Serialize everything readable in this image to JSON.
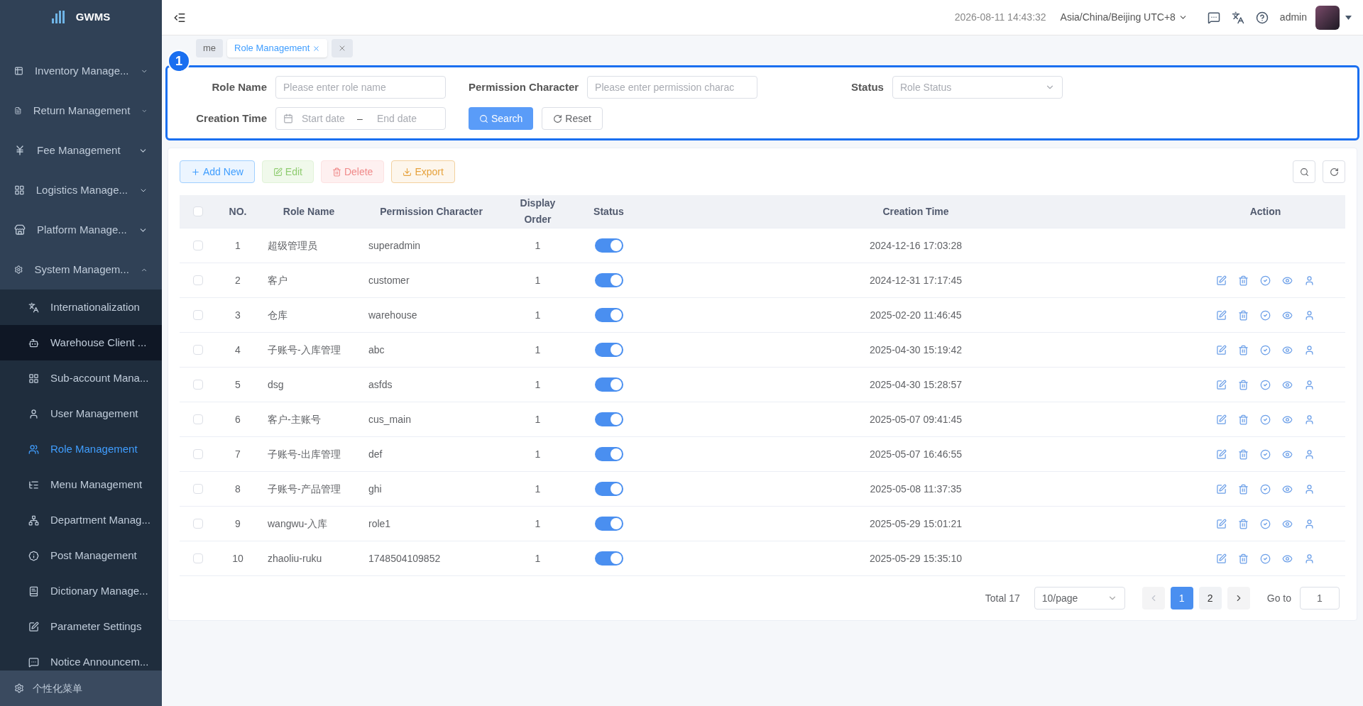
{
  "sidebar": {
    "logo": "GWMS",
    "items": [
      {
        "label": "Inventory Manage...",
        "expanded": false
      },
      {
        "label": "Return Management",
        "expanded": false
      },
      {
        "label": "Fee Management",
        "expanded": false
      },
      {
        "label": "Logistics Manage...",
        "expanded": false
      },
      {
        "label": "Platform Manage...",
        "expanded": false
      },
      {
        "label": "System Managem...",
        "expanded": true,
        "children": [
          {
            "label": "Internationalization",
            "selected": false
          },
          {
            "label": "Warehouse Client ...",
            "selected": false
          },
          {
            "label": "Sub-account Mana...",
            "selected": false
          },
          {
            "label": "User Management",
            "selected": false
          },
          {
            "label": "Role Management",
            "selected": true
          },
          {
            "label": "Menu Management",
            "selected": false
          },
          {
            "label": "Department Manag...",
            "selected": false
          },
          {
            "label": "Post Management",
            "selected": false
          },
          {
            "label": "Dictionary Manage...",
            "selected": false
          },
          {
            "label": "Parameter Settings",
            "selected": false
          },
          {
            "label": "Notice Announcem...",
            "selected": false
          }
        ]
      }
    ],
    "footer": "个性化菜单"
  },
  "header": {
    "datetime": "2026-08-11 14:43:32",
    "timezone": "Asia/China/Beijing UTC+8",
    "user": "admin"
  },
  "tabs": [
    {
      "kind": "page",
      "label": "me",
      "selected": false
    },
    {
      "kind": "page",
      "label": "Role Management",
      "selected": true
    },
    {
      "kind": "close-all",
      "selected": false
    }
  ],
  "callout": {
    "label": "1"
  },
  "filters": {
    "role_name": {
      "label": "Role Name",
      "placeholder": "Please enter role name"
    },
    "permission": {
      "label": "Permission Character",
      "placeholder": "Please enter permission charac"
    },
    "status": {
      "label": "Status",
      "placeholder": "Role Status"
    },
    "creation_time": {
      "label": "Creation Time",
      "start_placeholder": "Start date",
      "separator": "–",
      "end_placeholder": "End date"
    },
    "search": "Search",
    "reset": "Reset"
  },
  "toolbar": [
    {
      "kind": "primary",
      "label": "Add New",
      "disabled": false
    },
    {
      "kind": "success",
      "label": "Edit",
      "disabled": true
    },
    {
      "kind": "danger",
      "label": "Delete",
      "disabled": true
    },
    {
      "kind": "warning",
      "label": "Export",
      "disabled": false
    }
  ],
  "table": {
    "select_all_checked": false,
    "columns": [
      "NO.",
      "Role Name",
      "Permission Character",
      "Display Order",
      "Status",
      "Creation Time",
      "Action"
    ],
    "rows": [
      {
        "no": "1",
        "name": "超级管理员",
        "permission": "superadmin",
        "order": "1",
        "on": true,
        "time": "2024-12-16 17:03:28",
        "actions": false,
        "checked": false
      },
      {
        "no": "2",
        "name": "客户",
        "permission": "customer",
        "order": "1",
        "on": true,
        "time": "2024-12-31 17:17:45",
        "actions": true,
        "checked": false
      },
      {
        "no": "3",
        "name": "仓库",
        "permission": "warehouse",
        "order": "1",
        "on": true,
        "time": "2025-02-20 11:46:45",
        "actions": true,
        "checked": false
      },
      {
        "no": "4",
        "name": "子账号-入库管理",
        "permission": "abc",
        "order": "1",
        "on": true,
        "time": "2025-04-30 15:19:42",
        "actions": true,
        "checked": false
      },
      {
        "no": "5",
        "name": "dsg",
        "permission": "asfds",
        "order": "1",
        "on": true,
        "time": "2025-04-30 15:28:57",
        "actions": true,
        "checked": false
      },
      {
        "no": "6",
        "name": "客户-主账号",
        "permission": "cus_main",
        "order": "1",
        "on": true,
        "time": "2025-05-07 09:41:45",
        "actions": true,
        "checked": false
      },
      {
        "no": "7",
        "name": "子账号-出库管理",
        "permission": "def",
        "order": "1",
        "on": true,
        "time": "2025-05-07 16:46:55",
        "actions": true,
        "checked": false
      },
      {
        "no": "8",
        "name": "子账号-产品管理",
        "permission": "ghi",
        "order": "1",
        "on": true,
        "time": "2025-05-08 11:37:35",
        "actions": true,
        "checked": false
      },
      {
        "no": "9",
        "name": "wangwu-入库",
        "permission": "role1",
        "order": "1",
        "on": true,
        "time": "2025-05-29 15:01:21",
        "actions": true,
        "checked": false
      },
      {
        "no": "10",
        "name": "zhaoliu-ruku",
        "permission": "1748504109852",
        "order": "1",
        "on": true,
        "time": "2025-05-29 15:35:10",
        "actions": true,
        "checked": false
      }
    ]
  },
  "pagination": {
    "total": "Total 17",
    "page_size": "10/page",
    "pages": [
      {
        "label": "1",
        "selected": true
      },
      {
        "label": "2",
        "selected": false
      }
    ],
    "goto_label": "Go to",
    "goto_value": "1"
  }
}
